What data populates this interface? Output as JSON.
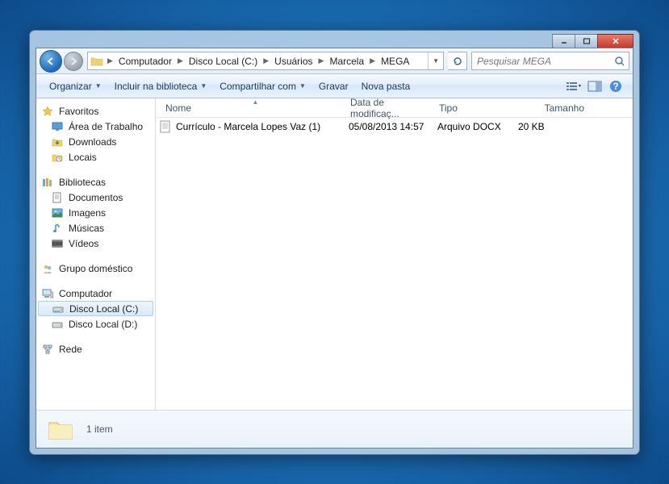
{
  "titlebar": {},
  "breadcrumb": {
    "items": [
      "Computador",
      "Disco Local (C:)",
      "Usuários",
      "Marcela",
      "MEGA"
    ]
  },
  "search": {
    "placeholder": "Pesquisar MEGA"
  },
  "toolbar": {
    "organize": "Organizar",
    "include": "Incluir na biblioteca",
    "share": "Compartilhar com",
    "burn": "Gravar",
    "newfolder": "Nova pasta"
  },
  "sidebar": {
    "favorites": {
      "label": "Favoritos",
      "items": [
        "Área de Trabalho",
        "Downloads",
        "Locais"
      ]
    },
    "libraries": {
      "label": "Bibliotecas",
      "items": [
        "Documentos",
        "Imagens",
        "Músicas",
        "Vídeos"
      ]
    },
    "homegroup": {
      "label": "Grupo doméstico"
    },
    "computer": {
      "label": "Computador",
      "items": [
        "Disco Local (C:)",
        "Disco Local (D:)"
      ]
    },
    "network": {
      "label": "Rede"
    }
  },
  "columns": {
    "name": "Nome",
    "date": "Data de modificaç...",
    "type": "Tipo",
    "size": "Tamanho"
  },
  "files": [
    {
      "name": "Currículo - Marcela Lopes Vaz (1)",
      "date": "05/08/2013 14:57",
      "type": "Arquivo DOCX",
      "size": "20 KB"
    }
  ],
  "status": {
    "count": "1 item"
  }
}
